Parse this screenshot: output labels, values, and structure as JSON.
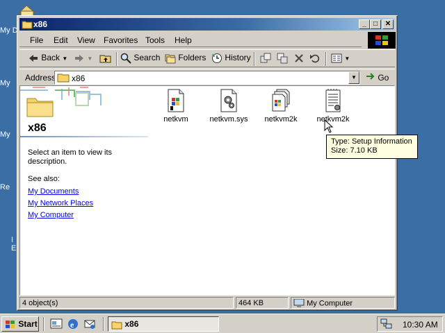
{
  "desktop": {
    "labels": [
      "My D",
      "My",
      "My",
      "Re",
      "I",
      "E"
    ]
  },
  "window": {
    "title": "x86",
    "controls": {
      "minimize": "_",
      "maximize": "□",
      "close": "✕"
    }
  },
  "menu": [
    "File",
    "Edit",
    "View",
    "Favorites",
    "Tools",
    "Help"
  ],
  "toolbar": {
    "back": "Back",
    "search": "Search",
    "folders": "Folders",
    "history": "History"
  },
  "address": {
    "label": "Address",
    "value": "x86",
    "go": "Go"
  },
  "webview": {
    "title": "x86",
    "description": "Select an item to view its description.",
    "see_also": "See also:",
    "links": [
      "My Documents",
      "My Network Places",
      "My Computer"
    ]
  },
  "files": [
    {
      "name": "netkvm",
      "icon": "catalog-file-icon"
    },
    {
      "name": "netkvm.sys",
      "icon": "system-file-icon"
    },
    {
      "name": "netkvm2k",
      "icon": "catalog-stack-icon"
    },
    {
      "name": "netkvm2k",
      "icon": "setup-information-icon"
    }
  ],
  "tooltip": {
    "line1": "Type: Setup Information",
    "line2": "Size: 7.10 KB"
  },
  "status": {
    "objects": "4 object(s)",
    "size": "464 KB",
    "zone": "My Computer"
  },
  "taskbar": {
    "start": "Start",
    "task": "x86",
    "clock": "10:30 AM"
  },
  "colors": {
    "desktop": "#3a6ea5",
    "title_active": "#0a246a",
    "face": "#d4d0c8",
    "link": "#0000ee",
    "tooltip": "#ffffe1"
  }
}
